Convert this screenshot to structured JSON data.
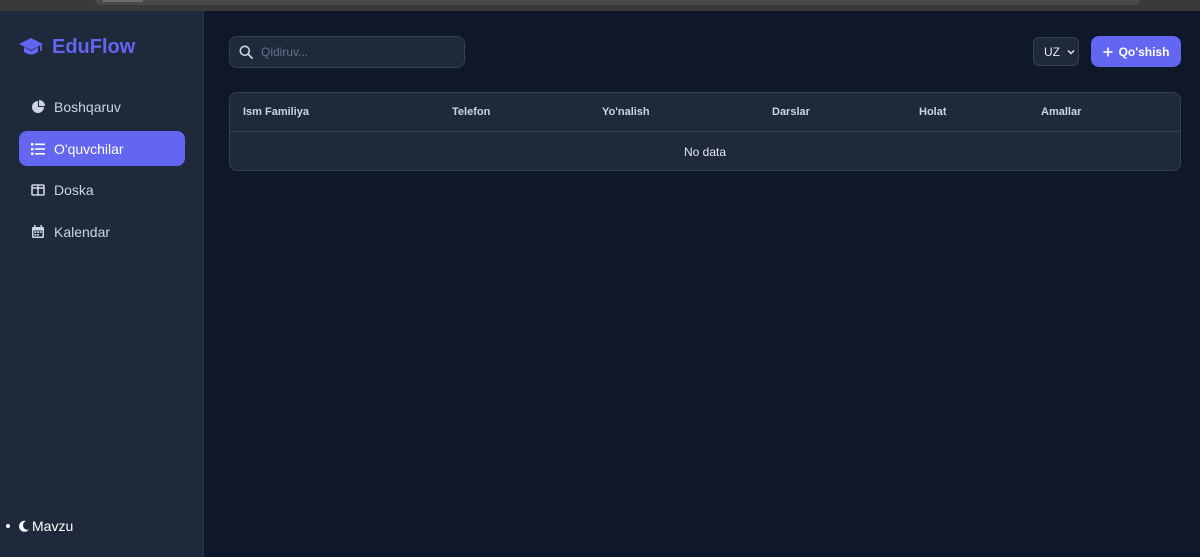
{
  "brand": {
    "name": "EduFlow",
    "icon": "graduation-cap-icon",
    "color": "#6366f1"
  },
  "sidebar": {
    "items": [
      {
        "label": "Boshqaruv",
        "icon": "pie-chart-icon",
        "active": false
      },
      {
        "label": "O'quvchilar",
        "icon": "list-icon",
        "active": true
      },
      {
        "label": "Doska",
        "icon": "board-icon",
        "active": false
      },
      {
        "label": "Kalendar",
        "icon": "calendar-icon",
        "active": false
      }
    ],
    "theme_toggle": {
      "label": "Mavzu",
      "icon": "moon-icon"
    }
  },
  "search": {
    "placeholder": "Qidiruv...",
    "value": "",
    "icon": "search-icon"
  },
  "language": {
    "selected": "UZ",
    "icon": "chevron-down-icon"
  },
  "add_button": {
    "label": "Qo'shish",
    "icon": "plus-icon"
  },
  "table": {
    "columns": [
      "Ism Familiya",
      "Telefon",
      "Yo'nalish",
      "Darslar",
      "Holat",
      "Amallar"
    ],
    "rows": [],
    "empty_text": "No data"
  },
  "colors": {
    "accent": "#6366f1",
    "background": "#0f172a",
    "panel": "#1e293b",
    "border": "#334155"
  }
}
